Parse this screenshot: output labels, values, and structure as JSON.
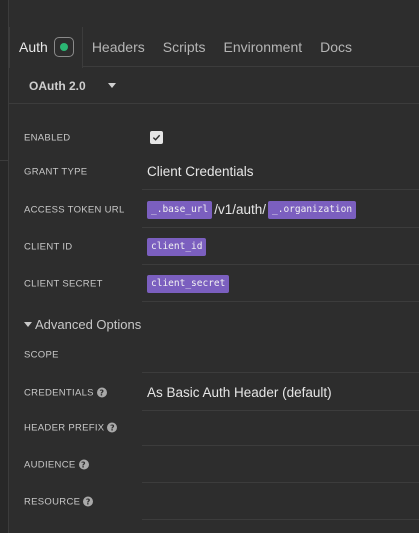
{
  "tabs": [
    {
      "label": "Auth"
    },
    {
      "label": "Headers"
    },
    {
      "label": "Scripts"
    },
    {
      "label": "Environment"
    },
    {
      "label": "Docs"
    }
  ],
  "auth_type": {
    "label": "OAuth 2.0"
  },
  "fields": {
    "enabled": {
      "label": "ENABLED",
      "checked": true
    },
    "grant_type": {
      "label": "GRANT TYPE",
      "value": "Client Credentials"
    },
    "access_token_url": {
      "label": "ACCESS TOKEN URL",
      "var1": "_.base_url",
      "middle": "/v1/auth/",
      "var2": "_.organization"
    },
    "client_id": {
      "label": "CLIENT ID",
      "var": "client_id"
    },
    "client_secret": {
      "label": "CLIENT SECRET",
      "var": "client_secret"
    }
  },
  "advanced": {
    "title": "Advanced Options",
    "scope": {
      "label": "SCOPE",
      "value": ""
    },
    "credentials": {
      "label": "CREDENTIALS",
      "value": "As Basic Auth Header (default)"
    },
    "header_prefix": {
      "label": "HEADER PREFIX",
      "value": ""
    },
    "audience": {
      "label": "AUDIENCE",
      "value": ""
    },
    "resource": {
      "label": "RESOURCE",
      "value": ""
    }
  },
  "colors": {
    "status_ok": "#2bb673",
    "variable_chip": "#7b5fbf",
    "background": "#2d2d2d"
  },
  "help_glyph": "?"
}
